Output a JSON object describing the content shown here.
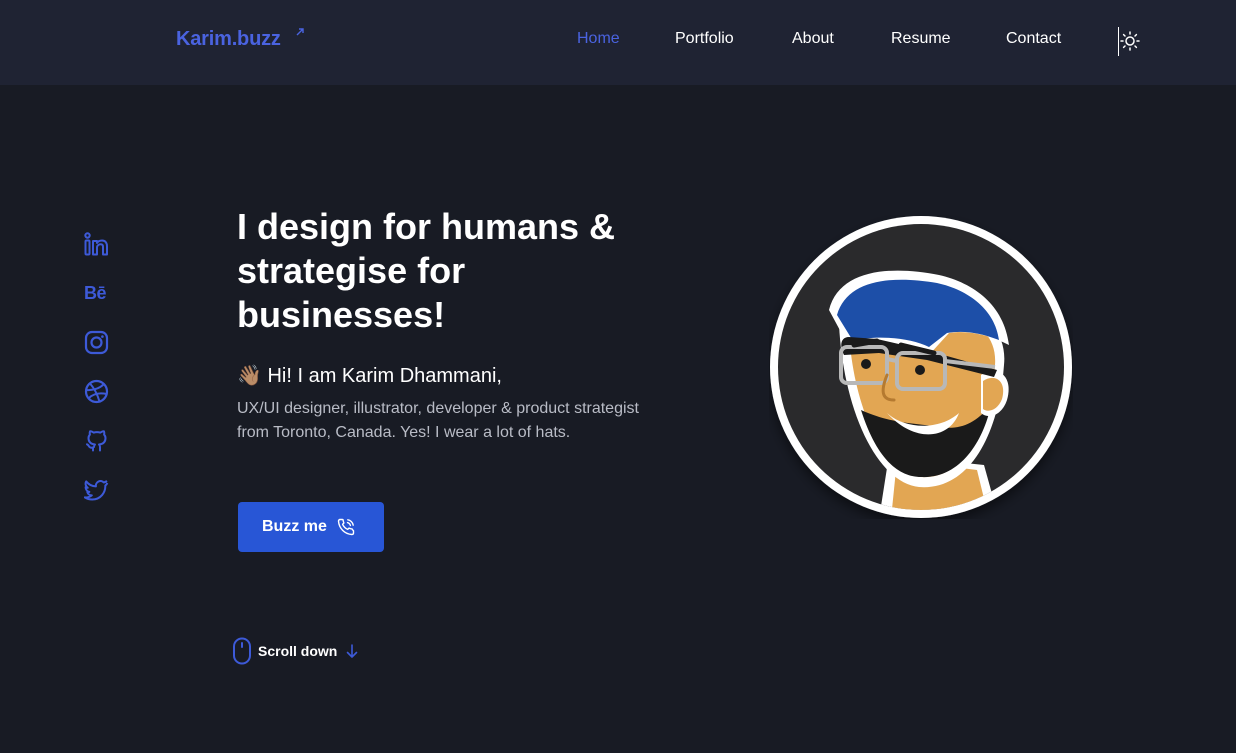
{
  "header": {
    "logo": "Karim.buzz",
    "nav": [
      {
        "label": "Home",
        "active": true
      },
      {
        "label": "Portfolio",
        "active": false
      },
      {
        "label": "About",
        "active": false
      },
      {
        "label": "Resume",
        "active": false
      },
      {
        "label": "Contact",
        "active": false
      }
    ],
    "theme_toggle_icon": "sun-icon"
  },
  "socials": [
    {
      "name": "linkedin-icon"
    },
    {
      "name": "behance-icon",
      "glyph": "Bē"
    },
    {
      "name": "instagram-icon"
    },
    {
      "name": "dribbble-icon"
    },
    {
      "name": "github-icon"
    },
    {
      "name": "twitter-icon"
    }
  ],
  "hero": {
    "headline": "I design for humans & strategise for businesses!",
    "greeting_emoji": "👋🏽",
    "greeting": "Hi! I am Karim Dhammani,",
    "description": "UX/UI designer, illustrator, developer & product strategist from Toronto, Canada. Yes! I wear a lot of hats.",
    "cta_label": "Buzz me",
    "cta_icon": "phone-icon",
    "scroll_label": "Scroll down",
    "avatar_icon": "avatar-illustration"
  },
  "colors": {
    "background": "#181b24",
    "header": "#1f2333",
    "accent": "#4a63e0",
    "button": "#2856d6",
    "text": "#ffffff",
    "muted_text": "#b9bcc6"
  }
}
